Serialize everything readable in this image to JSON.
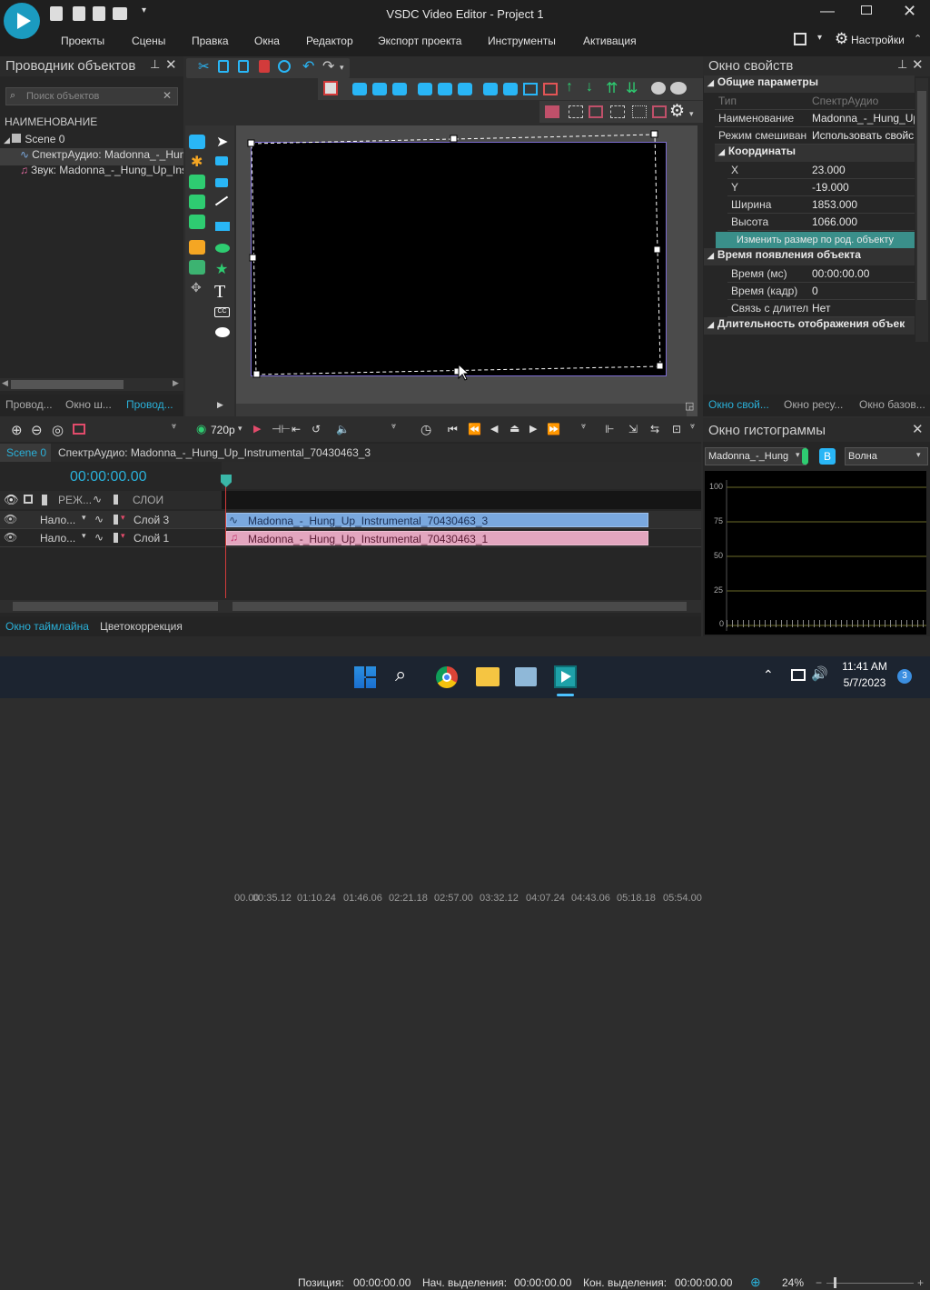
{
  "app": {
    "title": "VSDC Video Editor - Project 1",
    "menu": [
      "Проекты",
      "Сцены",
      "Правка",
      "Окна",
      "Редактор",
      "Экспорт проекта",
      "Инструменты",
      "Активация"
    ],
    "settings_label": "Настройки"
  },
  "explorer": {
    "title": "Проводник объектов",
    "search_placeholder": "Поиск объектов",
    "column": "НАИМЕНОВАНИЕ",
    "tree": [
      "Scene 0",
      "СпектрАудио: Madonna_-_Hun",
      "Звук: Madonna_-_Hung_Up_Ins"
    ],
    "tabs": [
      "Провод...",
      "Окно ш...",
      "Провод..."
    ]
  },
  "properties": {
    "title": "Окно свойств",
    "group_general": "Общие параметры",
    "rows_general": [
      {
        "k": "Тип",
        "v": "СпектрАудио"
      },
      {
        "k": "Наименование",
        "v": "Madonna_-_Hung_Up"
      },
      {
        "k": "Режим смешиван",
        "v": "Использовать свойс"
      }
    ],
    "group_coords": "Координаты",
    "rows_coords": [
      {
        "k": "X",
        "v": "23.000"
      },
      {
        "k": "Y",
        "v": "-19.000"
      },
      {
        "k": "Ширина",
        "v": "1853.000"
      },
      {
        "k": "Высота",
        "v": "1066.000"
      }
    ],
    "resize_button": "Изменить размер по род. объекту",
    "group_appear": "Время появления объекта",
    "rows_appear": [
      {
        "k": "Время (мс)",
        "v": "00:00:00.00"
      },
      {
        "k": "Время (кадр)",
        "v": "0"
      },
      {
        "k": "Связь с длител",
        "v": "Нет"
      }
    ],
    "group_duration": "Длительность отображения объек",
    "tabs": [
      "Окно свой...",
      "Окно ресу...",
      "Окно базов..."
    ]
  },
  "histogram": {
    "title": "Окно гистограммы",
    "source": "Madonna_-_Hung",
    "b_button": "B",
    "mode": "Волна",
    "y_ticks": [
      "100",
      "75",
      "50",
      "25",
      "0"
    ]
  },
  "timeline": {
    "resolution": "720p",
    "scene_tab": "Scene 0",
    "breadcrumb": "СпектрАудио: Madonna_-_Hung_Up_Instrumental_70430463_3",
    "current_time": "00:00:00.00",
    "ruler": [
      "00.00",
      "00:35.12",
      "01:10.24",
      "01:46.06",
      "02:21.18",
      "02:57.00",
      "03:32.12",
      "04:07.24",
      "04:43.06",
      "05:18.18",
      "05:54.00"
    ],
    "col_mode": "РЕЖ...",
    "col_layers": "СЛОИ",
    "tracks": [
      {
        "mode": "Нало...",
        "layer": "Слой 3",
        "clip": "Madonna_-_Hung_Up_Instrumental_70430463_3",
        "color": "#7aa8de"
      },
      {
        "mode": "Нало...",
        "layer": "Слой 1",
        "clip": "Madonna_-_Hung_Up_Instrumental_70430463_1",
        "color": "#e3a6bf"
      }
    ],
    "bottom_tabs": [
      "Окно таймлайна",
      "Цветокоррекция"
    ]
  },
  "status": {
    "position_label": "Позиция:",
    "position_value": "00:00:00.00",
    "sel_start_label": "Нач. выделения:",
    "sel_start_value": "00:00:00.00",
    "sel_end_label": "Кон. выделения:",
    "sel_end_value": "00:00:00.00",
    "zoom": "24%"
  },
  "taskbar": {
    "time": "11:41 AM",
    "date": "5/7/2023",
    "notifications": "3"
  },
  "colors": {
    "accent": "#2ab0d8",
    "toolbar_blue": "#29b6f6",
    "toolbar_green": "#2ecc71"
  }
}
